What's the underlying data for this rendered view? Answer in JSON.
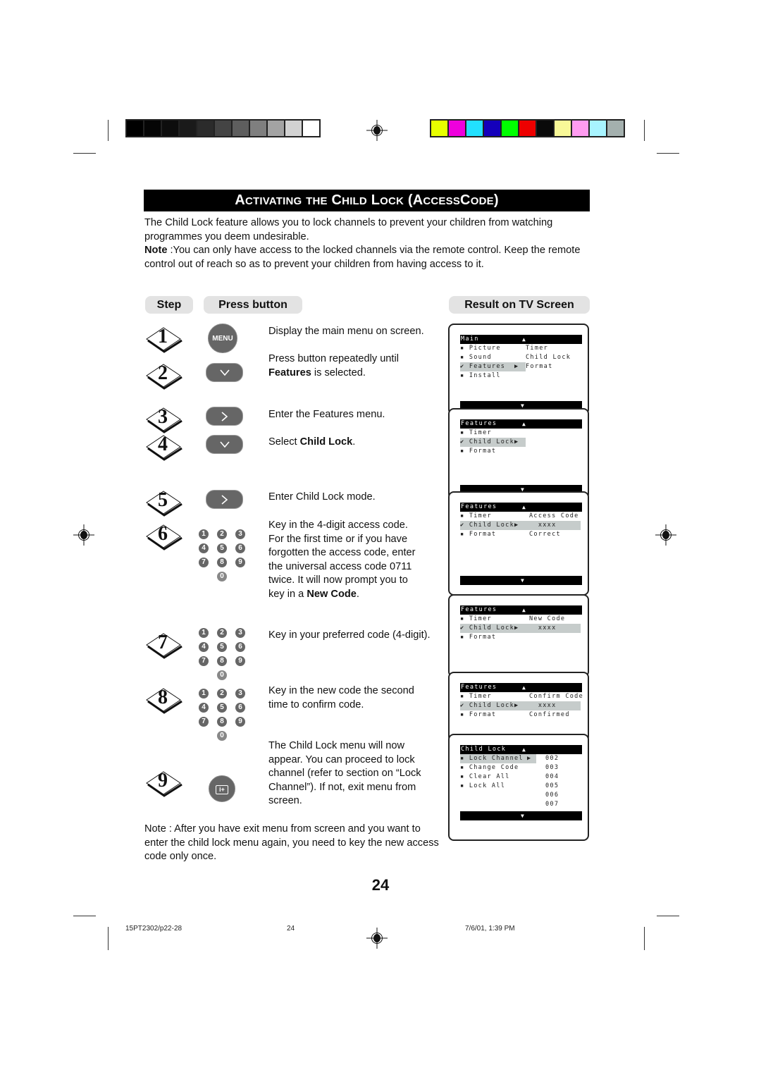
{
  "print_marks": {
    "gray_swatches": [
      "#000000",
      "#050505",
      "#0d0d0d",
      "#1a1a1a",
      "#2b2b2b",
      "#444444",
      "#5e5e5e",
      "#7f7f7f",
      "#a3a3a3",
      "#d2d2d2",
      "#ffffff"
    ],
    "color_swatches": [
      "#e8ff00",
      "#ee00dd",
      "#22e0ff",
      "#1400bb",
      "#00ff00",
      "#ee0000",
      "#0a0a0a",
      "#f8f898",
      "#ff9cf0",
      "#a8f4ff",
      "#a4b0ae"
    ]
  },
  "title": {
    "words": [
      {
        "cap": "A",
        "rest": "CTIVATING"
      },
      {
        "cap": "",
        "rest": "THE"
      },
      {
        "cap": "C",
        "rest": "HILD"
      },
      {
        "cap": "L",
        "rest": "OCK"
      },
      {
        "cap": "(A",
        "rest": "CCESS"
      },
      {
        "cap": "C",
        "rest": "ODE"
      },
      {
        "cap": ")",
        "rest": ""
      }
    ]
  },
  "intro": {
    "paragraph": "The Child Lock feature allows you to lock channels to prevent your children from watching programmes you deem undesirable.",
    "note_label": "Note",
    "note_text": " :You can only have access to the locked channels via the remote control. Keep the remote control out of reach so as to prevent your children from having access to it."
  },
  "headers": {
    "step": "Step",
    "press_button": "Press button",
    "result": "Result on TV Screen"
  },
  "steps": [
    {
      "number": "1",
      "button": "MENU",
      "button_icon": "menu-button",
      "text_pre": "Display the main menu on screen.",
      "text_bold": "",
      "text_post": ""
    },
    {
      "number": "2",
      "button_icon": "down-button",
      "text_pre": "Press button repeatedly until ",
      "text_bold": "Features",
      "text_post": " is selected."
    },
    {
      "number": "3",
      "button_icon": "right-button",
      "text_pre": "Enter the Features menu.",
      "text_bold": "",
      "text_post": ""
    },
    {
      "number": "4",
      "button_icon": "down-button",
      "text_pre": "Select ",
      "text_bold": "Child Lock",
      "text_post": "."
    },
    {
      "number": "5",
      "button_icon": "right-button",
      "text_pre": "Enter Child Lock mode.",
      "text_bold": "",
      "text_post": ""
    },
    {
      "number": "6",
      "button_icon": "digit-keypad",
      "text_pre": "Key in the 4-digit access code. For the first time or if you have forgotten the access code, enter the universal access code 0711 twice. It will now prompt you to key in a ",
      "text_bold": "New Code",
      "text_post": "."
    },
    {
      "number": "7",
      "button_icon": "digit-keypad",
      "text_pre": "Key in your preferred code (4-digit).",
      "text_bold": "",
      "text_post": ""
    },
    {
      "number": "8",
      "button_icon": "digit-keypad",
      "text_pre": "Key in the new code the second time to confirm code.",
      "text_bold": "",
      "text_post": ""
    },
    {
      "number": "9",
      "button_icon": "info-button",
      "text_pre": "The Child Lock menu will now appear. You can proceed to lock channel (refer to section on “Lock Channel”). If not, exit menu from screen.",
      "text_bold": "",
      "text_post": ""
    }
  ],
  "keypad_digits": [
    "1",
    "2",
    "3",
    "4",
    "5",
    "6",
    "7",
    "8",
    "9",
    "0"
  ],
  "final_note": "Note : After you have exit menu from screen and you want to enter the child lock menu again, you need to key the new access code only once.",
  "tv_screens": [
    {
      "header": "Main",
      "rows": [
        "▪ Picture",
        "▪ Sound",
        "✔ Features",
        "▪ Install"
      ],
      "selected": 2,
      "right": [
        "Timer",
        "Child Lock",
        "Format"
      ]
    },
    {
      "header": "Features",
      "rows": [
        "▪ Timer",
        "✔ Child Lock",
        "▪ Format"
      ],
      "selected": 1,
      "right": []
    },
    {
      "header": "Features",
      "rows": [
        "▪ Timer",
        "✔ Child Lock",
        "▪ Format"
      ],
      "selected": 1,
      "right": [
        "Access Code",
        "  xxxx",
        "Correct"
      ]
    },
    {
      "header": "Features",
      "rows": [
        "▪ Timer",
        "✔ Child Lock",
        "▪ Format"
      ],
      "selected": 1,
      "right": [
        "New Code",
        "  xxxx",
        ""
      ]
    },
    {
      "header": "Features",
      "rows": [
        "▪ Timer",
        "✔ Child Lock",
        "▪ Format"
      ],
      "selected": 1,
      "right": [
        "Confirm Code",
        "  xxxx",
        "Confirmed"
      ]
    },
    {
      "header": "Child Lock",
      "rows": [
        "▪ Lock Channel",
        "▪ Change Code",
        "▪ Clear All",
        "▪ Lock All"
      ],
      "selected": 0,
      "right": [
        "002",
        "003",
        "004",
        "005",
        "006",
        "007"
      ]
    }
  ],
  "page_number": "24",
  "footer": {
    "file": "15PT2302/p22-28",
    "page": "24",
    "datetime": "7/6/01, 1:39 PM"
  }
}
